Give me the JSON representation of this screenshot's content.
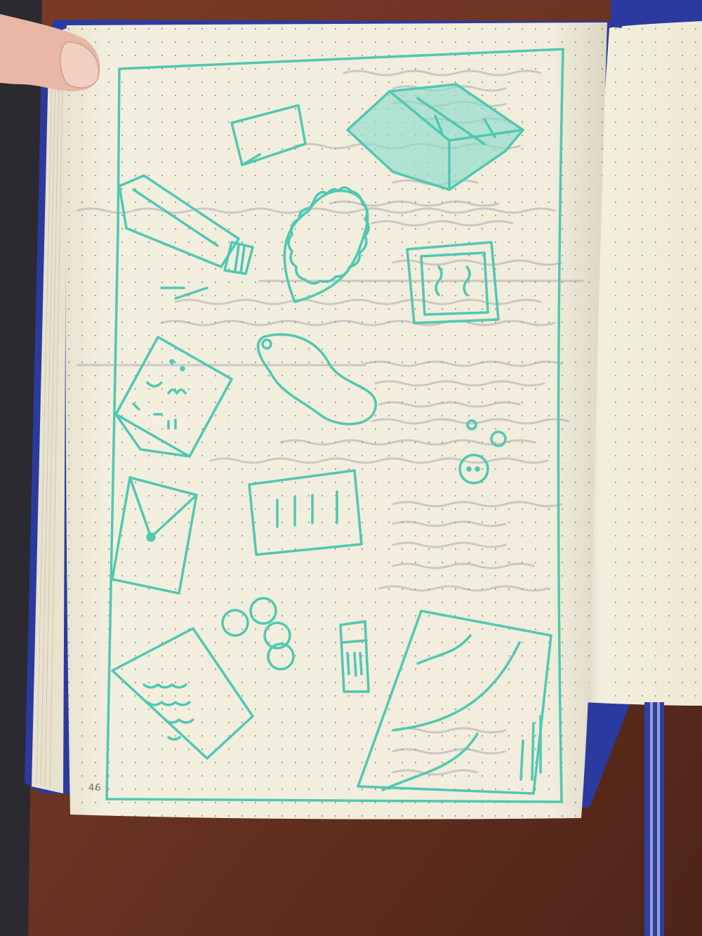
{
  "notebook": {
    "page_number": "46",
    "ink_color": "#4fc8b2",
    "paper_color": "#f2eedd",
    "cover_color": "#2b3a9e",
    "desk_color": "#6a3322"
  },
  "sketches": [
    {
      "name": "card"
    },
    {
      "name": "book-stack"
    },
    {
      "name": "tape-roll"
    },
    {
      "name": "heart-coaster"
    },
    {
      "name": "framed-picture"
    },
    {
      "name": "cracker"
    },
    {
      "name": "peanut-shape"
    },
    {
      "name": "envelope"
    },
    {
      "name": "ruled-card"
    },
    {
      "name": "coins"
    },
    {
      "name": "small-circles"
    },
    {
      "name": "lip-balm"
    },
    {
      "name": "letter-sheet"
    },
    {
      "name": "drawing-sheet"
    }
  ]
}
